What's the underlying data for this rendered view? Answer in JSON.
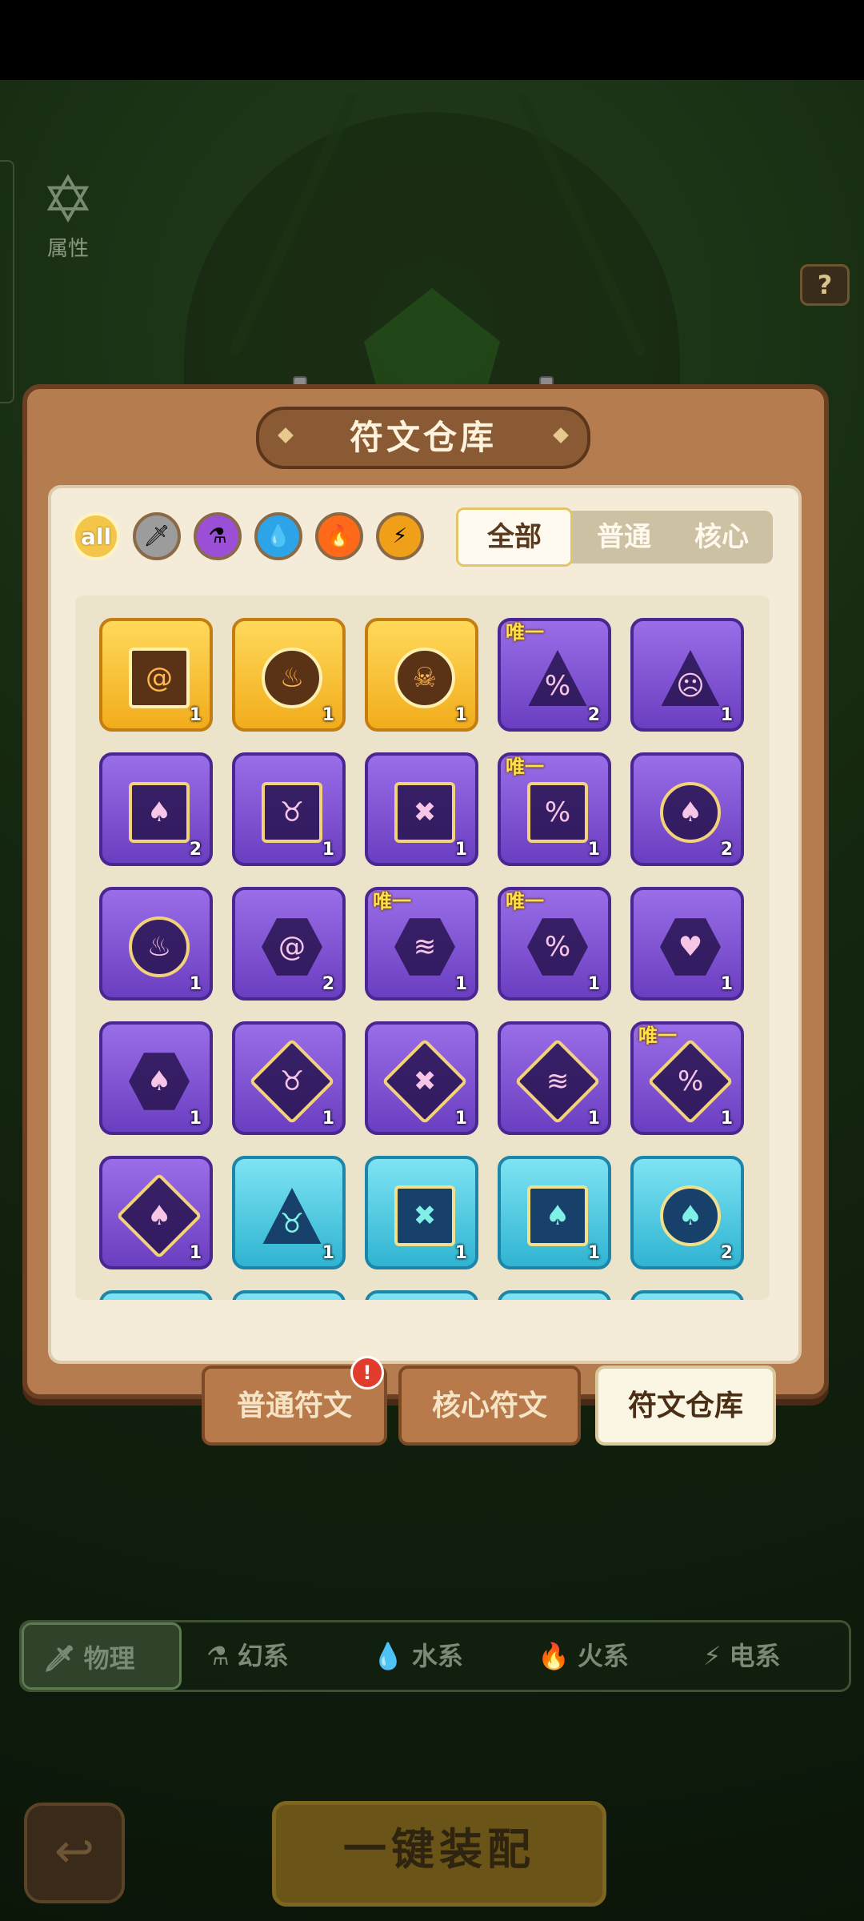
{
  "side": {
    "attribute_label": "属性",
    "help_label": "?"
  },
  "panel": {
    "title": "符文仓库"
  },
  "filters": {
    "elements": [
      {
        "label": "all",
        "icon": "all-icon",
        "color": "#f3c54a"
      },
      {
        "icon": "sword-icon",
        "color": "#9c9c9c"
      },
      {
        "icon": "potion-icon",
        "color": "#9a4fd6"
      },
      {
        "icon": "water-drop-icon",
        "color": "#2ea4e8"
      },
      {
        "icon": "fire-icon",
        "color": "#ff6a1a"
      },
      {
        "icon": "lightning-icon",
        "color": "#f0a018"
      }
    ],
    "categories": [
      {
        "label": "全部",
        "active": true
      },
      {
        "label": "普通",
        "active": false
      },
      {
        "label": "核心",
        "active": false
      }
    ]
  },
  "runes": [
    {
      "rarity": "gold",
      "shape": "square",
      "glyph": "@",
      "count": "1",
      "badge": ""
    },
    {
      "rarity": "gold",
      "shape": "circle",
      "glyph": "♨",
      "count": "1",
      "badge": ""
    },
    {
      "rarity": "gold",
      "shape": "circle",
      "glyph": "☠",
      "count": "1",
      "badge": ""
    },
    {
      "rarity": "purple",
      "shape": "tri",
      "glyph": "%",
      "count": "2",
      "badge": "唯一"
    },
    {
      "rarity": "purple",
      "shape": "tri",
      "glyph": "☹",
      "count": "1",
      "badge": ""
    },
    {
      "rarity": "purple",
      "shape": "square",
      "glyph": "♠",
      "count": "2",
      "badge": ""
    },
    {
      "rarity": "purple",
      "shape": "square",
      "glyph": "♉",
      "count": "1",
      "badge": ""
    },
    {
      "rarity": "purple",
      "shape": "square",
      "glyph": "✖",
      "count": "1",
      "badge": ""
    },
    {
      "rarity": "purple",
      "shape": "square",
      "glyph": "%",
      "count": "1",
      "badge": "唯一"
    },
    {
      "rarity": "purple",
      "shape": "circle",
      "glyph": "♠",
      "count": "2",
      "badge": ""
    },
    {
      "rarity": "purple",
      "shape": "circle",
      "glyph": "♨",
      "count": "1",
      "badge": ""
    },
    {
      "rarity": "purple",
      "shape": "hex",
      "glyph": "@",
      "count": "2",
      "badge": ""
    },
    {
      "rarity": "purple",
      "shape": "hex",
      "glyph": "≋",
      "count": "1",
      "badge": "唯一"
    },
    {
      "rarity": "purple",
      "shape": "hex",
      "glyph": "%",
      "count": "1",
      "badge": "唯一"
    },
    {
      "rarity": "purple",
      "shape": "hex",
      "glyph": "♥",
      "count": "1",
      "badge": ""
    },
    {
      "rarity": "purple",
      "shape": "hex",
      "glyph": "♠",
      "count": "1",
      "badge": ""
    },
    {
      "rarity": "purple",
      "shape": "diamond",
      "glyph": "♉",
      "count": "1",
      "badge": ""
    },
    {
      "rarity": "purple",
      "shape": "diamond",
      "glyph": "✖",
      "count": "1",
      "badge": ""
    },
    {
      "rarity": "purple",
      "shape": "diamond",
      "glyph": "≋",
      "count": "1",
      "badge": ""
    },
    {
      "rarity": "purple",
      "shape": "diamond",
      "glyph": "%",
      "count": "1",
      "badge": "唯一"
    },
    {
      "rarity": "purple",
      "shape": "diamond",
      "glyph": "♠",
      "count": "1",
      "badge": ""
    },
    {
      "rarity": "cyan",
      "shape": "tri",
      "glyph": "♉",
      "count": "1",
      "badge": ""
    },
    {
      "rarity": "cyan",
      "shape": "square",
      "glyph": "✖",
      "count": "1",
      "badge": ""
    },
    {
      "rarity": "cyan",
      "shape": "square",
      "glyph": "♠",
      "count": "1",
      "badge": ""
    },
    {
      "rarity": "cyan",
      "shape": "circle",
      "glyph": "♠",
      "count": "2",
      "badge": ""
    }
  ],
  "tabs": [
    {
      "label": "普通符文",
      "active": false,
      "alert": "!"
    },
    {
      "label": "核心符文",
      "active": false
    },
    {
      "label": "符文仓库",
      "active": true
    }
  ],
  "element_bar": [
    {
      "label": "物理",
      "icon": "sword-icon",
      "selected": true
    },
    {
      "label": "幻系",
      "icon": "potion-icon",
      "selected": false
    },
    {
      "label": "水系",
      "icon": "water-drop-icon",
      "selected": false
    },
    {
      "label": "火系",
      "icon": "fire-icon",
      "selected": false
    },
    {
      "label": "电系",
      "icon": "lightning-icon",
      "selected": false
    }
  ],
  "actions": {
    "equip_label": "一键装配",
    "back_icon": "back-arrow-icon"
  }
}
